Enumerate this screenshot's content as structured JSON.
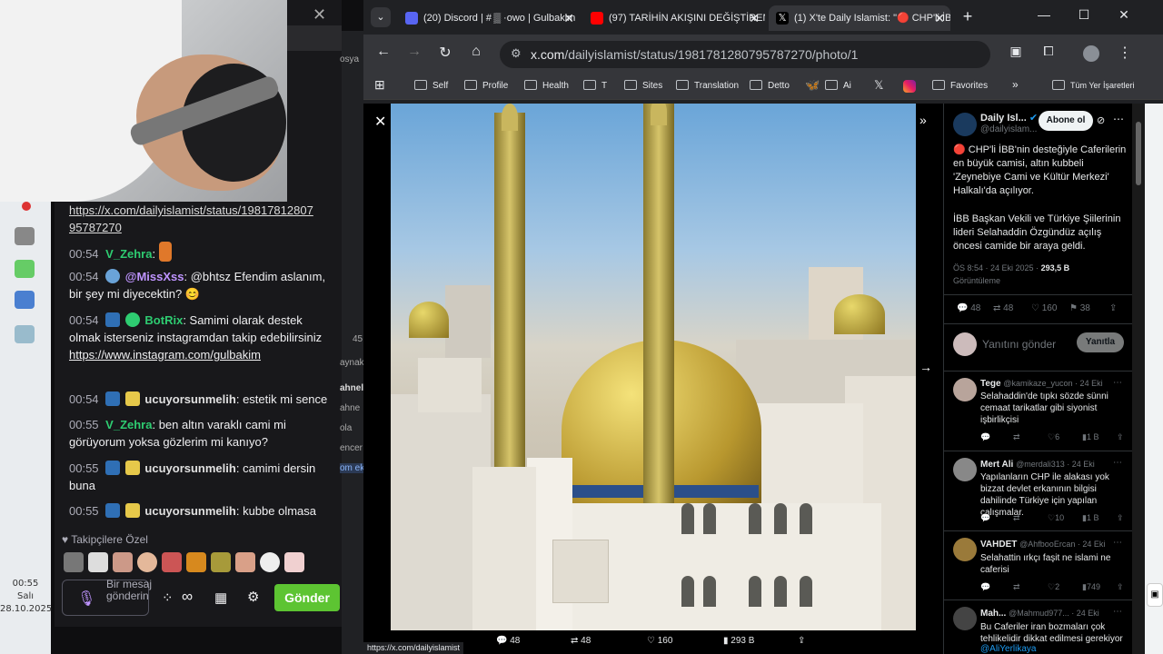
{
  "browser": {
    "tabs": [
      {
        "label": "(20) Discord | # ▒ ·owo | Gulbakim",
        "badge": "20"
      },
      {
        "label": "(97) TARİHİN AKIŞINI DEĞİŞTİREN BÜYÜ"
      },
      {
        "label": "(1) X'te Daily Islamist: \"🔴 CHP'li İBB'n"
      }
    ],
    "url": "x.com/dailyislamist/status/1981781280795787270/photo/1",
    "url_domain": "x.com",
    "url_path": "/dailyislamist/status/1981781280795787270/photo/1",
    "bookmarks": [
      "Self",
      "Profile",
      "Health",
      "T",
      "Sites",
      "Translation",
      "Detto",
      "Ai",
      "Favorites",
      "Tüm Yer İşaretleri"
    ],
    "status_url": "https://x.com/dailyislamist"
  },
  "tweet": {
    "author_name": "Daily Isl...",
    "author_handle": "@dailyislam...",
    "subscribe_label": "Abone ol",
    "text1": "🔴 CHP'li İBB'nin desteğiyle Caferilerin en büyük camisi, altın kubbeli 'Zeynebiye Cami ve Kültür Merkezi' Halkalı'da açılıyor.",
    "text2": "İBB Başkan Vekili ve Türkiye Şiilerinin lideri Selahaddin Özgündüz açılış öncesi camide bir araya geldi.",
    "meta": "ÖS 8:54 · 24 Eki 2025 · ",
    "views": "293,5 B",
    "views_label": "Görüntüleme",
    "replies": "48",
    "reposts": "48",
    "likes": "160",
    "bookmarks": "38",
    "reply_placeholder": "Yanıtını gönder",
    "reply_button": "Yanıtla"
  },
  "replies": [
    {
      "name": "Tege",
      "handle": "@kamikaze_yucon · 24 Eki",
      "text": "Selahaddin'de tıpkı sözde sünni cemaat tarikatlar gibi siyonist işbirlikçisi",
      "likes": "6",
      "views": "1 B"
    },
    {
      "name": "Mert Ali",
      "handle": "@merdali313 · 24 Eki",
      "text": "Yapılanların CHP ile alakası yok bizzat devlet erkanının bilgisi dahilinde Türkiye için yapılan çalışmalar.",
      "likes": "10",
      "views": "1 B"
    },
    {
      "name": "VAHDET",
      "handle": "@AhfbooErcan · 24 Eki",
      "text": "Selahattin ırkçı faşit ne islami ne caferisi",
      "likes": "2",
      "views": "749"
    },
    {
      "name": "Mah...",
      "handle": "@Mahmud977... · 24 Eki",
      "text": "Bu Caferiler iran bozmaları çok tehlikelidir dikkat edilmesi gerekiyor",
      "mention": "@AliYerlikaya"
    }
  ],
  "photo_actions": {
    "replies": "48",
    "reposts": "48",
    "likes": "160",
    "views": "293 B"
  },
  "chat": {
    "link1": "https://x.com/dailyislamist/status/19817812807 95787270",
    "messages": [
      {
        "time": "00:54",
        "user": "V_Zehra",
        "text": ""
      },
      {
        "time": "00:54",
        "user": "@MissXss",
        "text": ": @bhtsz Efendim aslanım, bir şey mi diyecektin? 😊"
      },
      {
        "time": "00:54",
        "user": "BotRix",
        "text": ": Samimi olarak destek olmak isterseniz instagramdan takip edebilirsiniz",
        "link": "https://www.instagram.com/gulbakim"
      },
      {
        "time": "00:54",
        "user": "ucuyorsunmelih",
        "text": ": estetik mi sence"
      },
      {
        "time": "00:55",
        "user": "V_Zehra",
        "text": ": ben altın varaklı cami mi görüyorum yoksa gözlerim mi kanıyo?"
      },
      {
        "time": "00:55",
        "user": "ucuyorsunmelih",
        "text": ": camimi dersin buna"
      },
      {
        "time": "00:55",
        "user": "ucuyorsunmelih",
        "text": ": kubbe olmasa"
      }
    ],
    "followers_label": "Takipçilere Özel",
    "input_placeholder": "Bir mesaj gönderin",
    "send_label": "Gönder"
  },
  "mid_fragments": [
    "osya",
    "45",
    "aynak",
    "ahnel",
    "ahne",
    "ola",
    "encer",
    "om ek"
  ],
  "clock": {
    "time": "00:55",
    "day": "Salı",
    "date": "28.10.2025"
  },
  "colors": {
    "twitch_purple": "#9147ff",
    "send_green": "#5dc432",
    "x_blue": "#1d9bf0",
    "zehra_green": "#2ecc71"
  }
}
